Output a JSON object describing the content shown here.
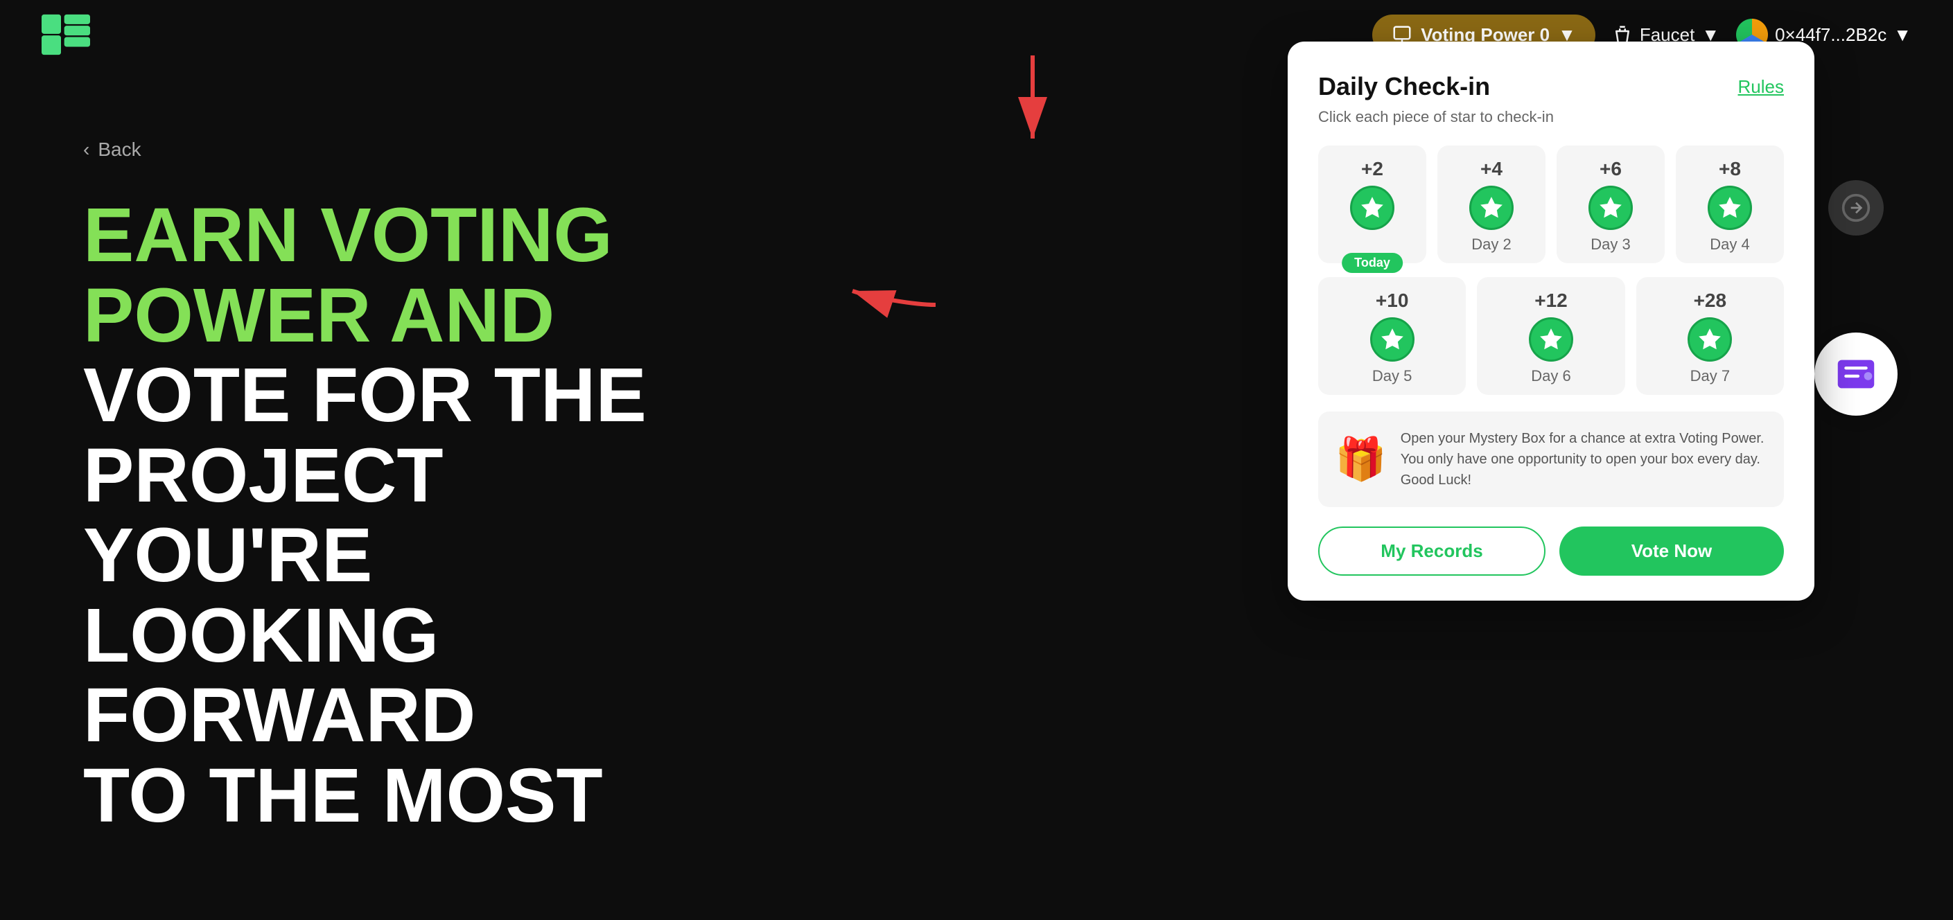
{
  "navbar": {
    "logo_alt": "Logo",
    "voting_power_label": "Voting Power 0",
    "faucet_label": "Faucet",
    "wallet_address": "0×44f7...2B2c"
  },
  "hero": {
    "back_label": "Back",
    "heading_line1_green": "EARN VOTING",
    "heading_line2_green": "POWER AND",
    "heading_line3_white": "VOTE FOR THE",
    "heading_line4_white": "PROJECT YOU'RE",
    "heading_line5_white": "LOOKING FORWARD",
    "heading_line6_white": "TO THE MOST"
  },
  "checkin": {
    "title": "Daily Check-in",
    "rules_label": "Rules",
    "subtitle": "Click each piece of star to check-in",
    "days": [
      {
        "points": "+2",
        "label": "Today",
        "is_today": true
      },
      {
        "points": "+4",
        "label": "Day 2",
        "is_today": false
      },
      {
        "points": "+6",
        "label": "Day 3",
        "is_today": false
      },
      {
        "points": "+8",
        "label": "Day 4",
        "is_today": false
      },
      {
        "points": "+10",
        "label": "Day 5",
        "is_today": false
      },
      {
        "points": "+12",
        "label": "Day 6",
        "is_today": false
      },
      {
        "points": "+28",
        "label": "Day 7",
        "is_today": false
      }
    ],
    "mystery_box_text": "Open your Mystery Box for a chance at extra Voting Power. You only have one opportunity to open your box every day. Good Luck!",
    "my_records_label": "My Records",
    "vote_now_label": "Vote Now"
  }
}
